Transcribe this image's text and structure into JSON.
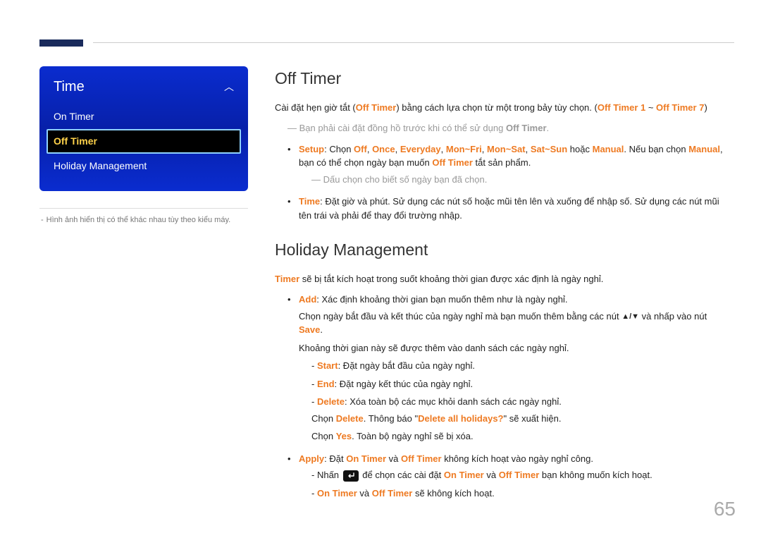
{
  "decor": {
    "page_number": "65"
  },
  "left": {
    "menu": {
      "title": "Time",
      "items": [
        "On Timer",
        "Off Timer",
        "Holiday Management"
      ],
      "active_index": 1
    },
    "caption": {
      "dash": "-",
      "text": "Hình ảnh hiển thị có thể khác nhau tùy theo kiểu máy."
    }
  },
  "right": {
    "h1": "Off Timer",
    "p1_a": "Cài đặt hẹn giờ tắt (",
    "p1_b": "Off Timer",
    "p1_c": ") bằng cách lựa chọn từ một trong bảy tùy chọn. (",
    "p1_d": "Off Timer 1",
    "p1_e": " ~ ",
    "p1_f": "Off Timer 7",
    "p1_g": ")",
    "note1_a": "Bạn phải cài đặt đồng hồ trước khi có thể sử dụng ",
    "note1_b": "Off Timer",
    "note1_c": ".",
    "setup": {
      "label": "Setup",
      "text_a": ": Chọn ",
      "opts": [
        "Off",
        "Once",
        "Everyday",
        "Mon~Fri",
        "Mon~Sat",
        "Sat~Sun"
      ],
      "or": " hoặc ",
      "manual": "Manual",
      "text_b": ". Nếu bạn chọn ",
      "text_c": ", bạn có thể chọn ngày bạn muốn ",
      "offtimer": "Off Timer",
      "text_d": " tắt sản phẩm.",
      "sub_note": "Dấu chọn cho biết số ngày bạn đã chọn."
    },
    "time": {
      "label": "Time",
      "text": ": Đặt giờ và phút. Sử dụng các nút số hoặc mũi tên lên và xuống để nhập số. Sử dụng các nút mũi tên trái và phải để thay đổi trường nhập."
    },
    "h2": "Holiday Management",
    "hm_p1_a": "Timer",
    "hm_p1_b": " sẽ bị tắt kích hoạt trong suốt khoảng thời gian được xác định là ngày nghỉ.",
    "add": {
      "label": "Add",
      "text_a": ": Xác định khoảng thời gian bạn muốn thêm như là ngày nghỉ.",
      "text_b_a": "Chọn ngày bắt đầu và kết thúc của ngày nghỉ mà bạn muốn thêm bằng các nút ",
      "text_b_b": " và nhấp vào nút ",
      "save": "Save",
      "text_b_c": ".",
      "text_c": "Khoảng thời gian này sẽ được thêm vào danh sách các ngày nghỉ.",
      "start": {
        "lab": "Start",
        "txt": ": Đặt ngày bắt đầu của ngày nghỉ."
      },
      "end": {
        "lab": "End",
        "txt": ": Đặt ngày kết thúc của ngày nghỉ."
      },
      "delete": {
        "lab": "Delete",
        "txt_a": ": Xóa toàn bộ các mục khỏi danh sách các ngày nghỉ.",
        "txt_b_a": "Chọn ",
        "del": "Delete",
        "txt_b_b": ". Thông báo \"",
        "msg": "Delete all holidays?",
        "txt_b_c": "\" sẽ xuất hiện.",
        "txt_c_a": "Chọn ",
        "yes": "Yes",
        "txt_c_b": ". Toàn bộ ngày nghỉ sẽ bị xóa."
      }
    },
    "apply": {
      "label": "Apply",
      "text_a": ": Đặt ",
      "on": "On Timer",
      "and": " và ",
      "off": "Off Timer",
      "text_b": " không kích hoạt vào ngày nghỉ công.",
      "sub1_a": "Nhấn ",
      "sub1_b": " để chọn các cài đặt ",
      "sub1_c": " bạn không muốn kích hoạt.",
      "sub2_a": "On Timer",
      "sub2_b": " và ",
      "sub2_c": "Off Timer",
      "sub2_d": " sẽ không kích hoạt."
    }
  }
}
